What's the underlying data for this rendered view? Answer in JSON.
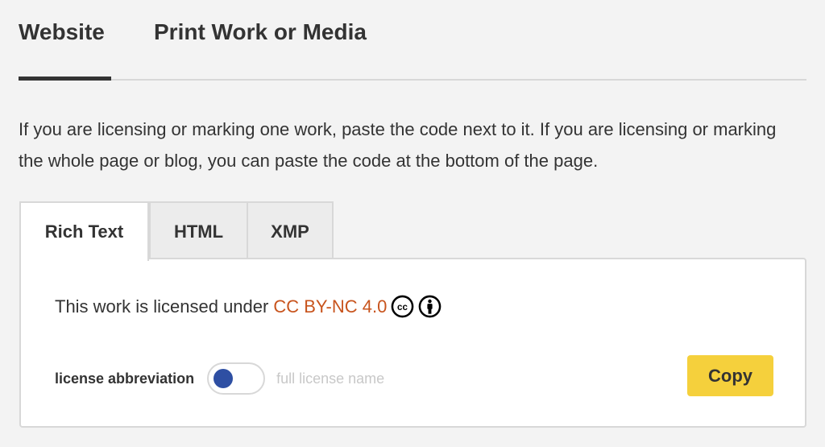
{
  "top_tabs": [
    {
      "label": "Website",
      "active": true
    },
    {
      "label": "Print Work or Media",
      "active": false
    }
  ],
  "intro_text": "If you are licensing or marking one work, paste the code next to it. If you are licensing or marking the whole page or blog, you can paste the code at the bottom of the page.",
  "code_tabs": [
    {
      "label": "Rich Text",
      "active": true
    },
    {
      "label": "HTML",
      "active": false
    },
    {
      "label": "XMP",
      "active": false
    }
  ],
  "panel": {
    "license_prefix": "This work is licensed under",
    "license_link": "CC BY-NC 4.0",
    "icons": [
      "cc-icon",
      "by-icon"
    ],
    "toggle": {
      "left_label": "license abbreviation",
      "right_label": "full license name",
      "state": "license abbreviation"
    },
    "copy_label": "Copy"
  },
  "colors": {
    "accent_link": "#c8541d",
    "button": "#f5d03c",
    "toggle_knob": "#2e4fa3"
  }
}
